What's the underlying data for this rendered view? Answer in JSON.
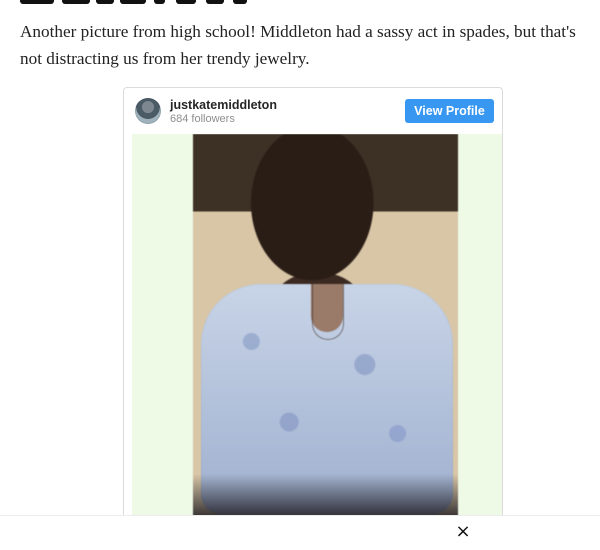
{
  "article": {
    "paragraph": "Another picture from high school! Middleton had a sassy act in spades, but that's not distracting us from her trendy jewelry."
  },
  "instagram_embed": {
    "username": "justkatemiddleton",
    "followers": "684 followers",
    "view_profile_label": "View Profile",
    "button_color": "#3897f0",
    "photo_background": "#eef9e6"
  },
  "overlay": {
    "close_label": "×"
  }
}
